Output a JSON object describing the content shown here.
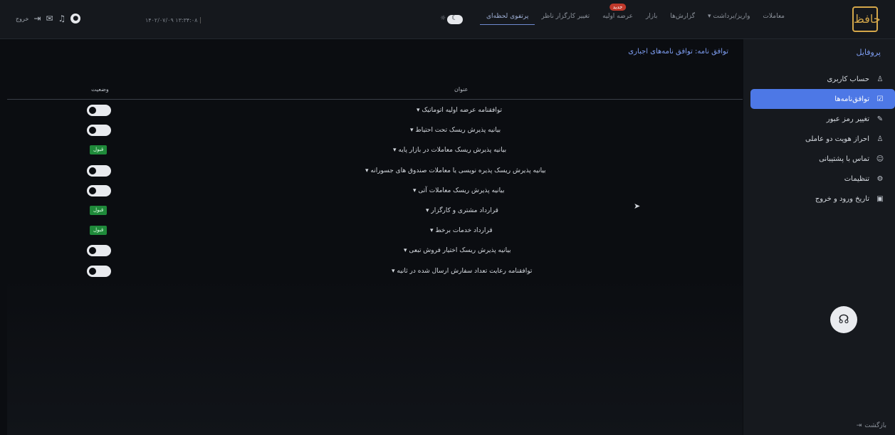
{
  "topbar": {
    "logo": "حافظ",
    "nav": [
      {
        "label": "معاملات",
        "active": false
      },
      {
        "label": "واریز/برداشت ▾",
        "active": false
      },
      {
        "label": "گزارش‌ها",
        "active": false
      },
      {
        "label": "بازار",
        "active": false
      },
      {
        "label": "عرضه اولیه",
        "active": false,
        "badge": "جدید"
      },
      {
        "label": "تغییر کارگزار ناظر",
        "active": false
      },
      {
        "label": "پرتفوی لحظه‌ای",
        "active": true
      }
    ],
    "datetime": "۱۴۰۲/۰۷/۰۹ ۱۳:۳۴:۰۸",
    "exit_label": "خروج"
  },
  "sidebar": {
    "title": "پروفایل",
    "items": [
      {
        "label": "حساب کاربری",
        "icon": "user-icon",
        "active": false
      },
      {
        "label": "توافق‌نامه‌ها",
        "icon": "document-check-icon",
        "active": true
      },
      {
        "label": "تغییر رمز عبور",
        "icon": "document-edit-icon",
        "active": false
      },
      {
        "label": "احراز هویت دو عاملی",
        "icon": "user-shield-icon",
        "active": false
      },
      {
        "label": "تماس با پشتیبانی",
        "icon": "support-user-icon",
        "active": false
      },
      {
        "label": "تنظیمات",
        "icon": "gear-icon",
        "active": false
      },
      {
        "label": "تاریخ ورود و خروج",
        "icon": "calendar-icon",
        "active": false
      }
    ],
    "back_label": "بازگشت"
  },
  "main": {
    "page_title": "توافق نامه: توافق نامه‌های اجباری",
    "columns": {
      "title": "عنوان",
      "status": "وضعیت"
    },
    "rows": [
      {
        "title": "توافقنامه عرضه اولیه اتوماتیک ▾",
        "status": "toggle"
      },
      {
        "title": "بیانیه پذیرش ریسک تحت احتیاط ▾",
        "status": "toggle"
      },
      {
        "title": "بیانیه پذیرش ریسک معاملات در بازار پایه ▾",
        "status": "badge"
      },
      {
        "title": "بیانیه پذیرش ریسک پذیره نویسی یا معاملات صندوق های جسورانه ▾",
        "status": "toggle"
      },
      {
        "title": "بیانیه پذیرش ریسک معاملات آتی ▾",
        "status": "toggle"
      },
      {
        "title": "قرارداد مشتری و کارگزار ▾",
        "status": "badge"
      },
      {
        "title": "قرارداد خدمات برخط ▾",
        "status": "badge"
      },
      {
        "title": "بیانیه پذیرش ریسک اختیار فروش تبعی ▾",
        "status": "toggle"
      },
      {
        "title": "توافقنامه رعایت تعداد سفارش ارسال شده در ثانیه ▾",
        "status": "toggle"
      }
    ],
    "badge_label": "قبول"
  },
  "colors": {
    "accent": "#4d78e6",
    "accept": "#1f8a3a",
    "brand": "#d4a74a"
  }
}
